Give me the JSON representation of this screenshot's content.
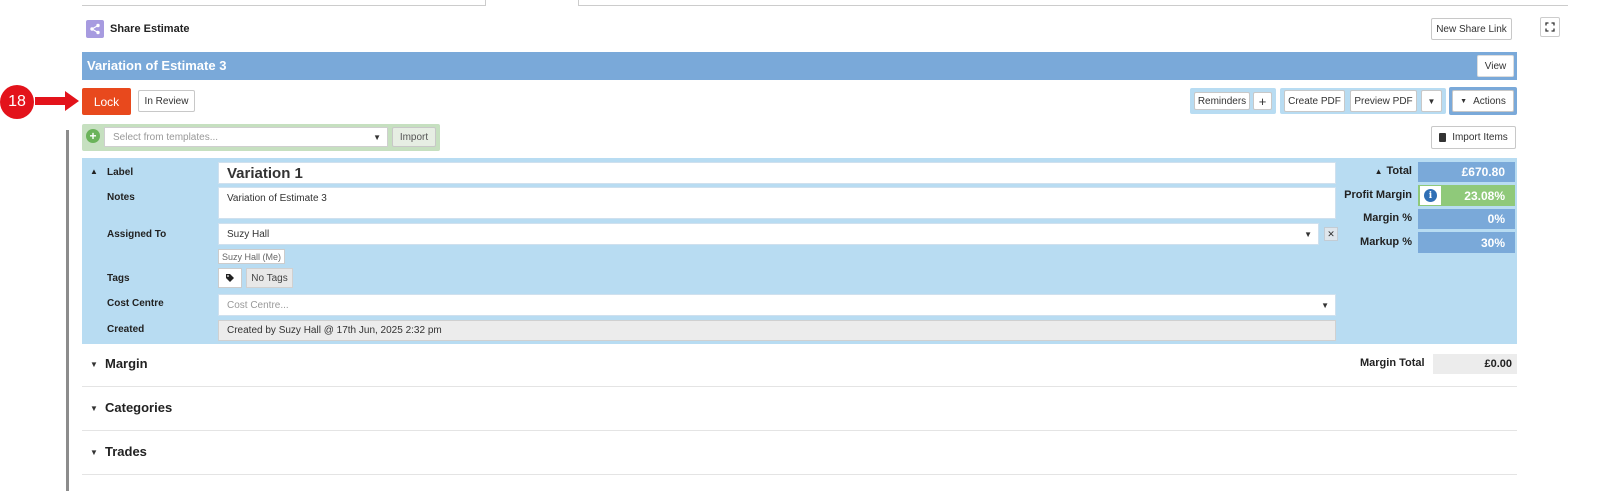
{
  "share": {
    "title": "Share Estimate",
    "new_link": "New Share Link"
  },
  "header": {
    "title": "Variation of Estimate 3",
    "view": "View"
  },
  "toolbar": {
    "step_number": "18",
    "lock": "Lock",
    "status": "In Review",
    "reminders": "Reminders",
    "plus": "+",
    "create_pdf": "Create PDF",
    "preview_pdf": "Preview PDF",
    "actions": "Actions"
  },
  "templates": {
    "placeholder": "Select from templates...",
    "import": "Import",
    "import_items": "Import Items"
  },
  "details": {
    "label_label": "Label",
    "label_value": "Variation 1",
    "notes_label": "Notes",
    "notes_value": "Variation of Estimate 3",
    "assigned_label": "Assigned To",
    "assigned_value": "Suzy Hall",
    "assigned_suggestion": "Suzy Hall (Me)",
    "tags_label": "Tags",
    "tags_value": "No Tags",
    "cost_centre_label": "Cost Centre",
    "cost_centre_placeholder": "Cost Centre...",
    "created_label": "Created",
    "created_value": "Created by Suzy Hall @ 17th Jun, 2025 2:32 pm"
  },
  "summary": {
    "total_label": "Total",
    "total_value": "£670.80",
    "profit_margin_label": "Profit Margin",
    "profit_margin_value": "23.08%",
    "margin_pct_label": "Margin %",
    "margin_pct_value": "0%",
    "markup_pct_label": "Markup %",
    "markup_pct_value": "30%"
  },
  "sections": {
    "margin": "Margin",
    "margin_total_label": "Margin Total",
    "margin_total_value": "£0.00",
    "categories": "Categories",
    "trades": "Trades"
  },
  "colors": {
    "header_blue": "#7aa9d9",
    "panel_blue": "#b8dcf2",
    "lock_red": "#e8491d",
    "profit_green": "#8fc97a",
    "template_green": "#c6e0c0",
    "annotation_red": "#e3131b"
  }
}
